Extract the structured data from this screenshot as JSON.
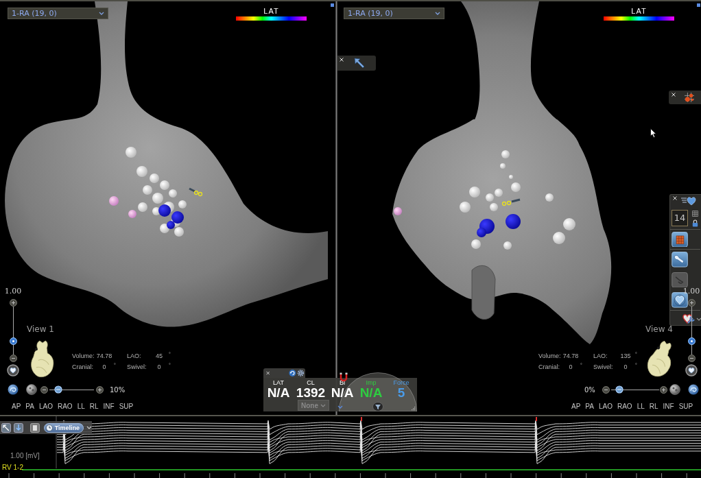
{
  "views": [
    {
      "map_selector": "1-RA (19, 0)",
      "scale_label": "LAT",
      "title": "View 1",
      "zoom": {
        "reading": "1.00",
        "level": 0.28
      },
      "stats": [
        {
          "label": "Volume:",
          "value": "74.78"
        },
        {
          "label": "LAO:",
          "value": "45",
          "unit": "°"
        },
        {
          "label": "Cranial:",
          "value": "0",
          "unit": "°"
        },
        {
          "label": "Swivel:",
          "value": "0",
          "unit": "°"
        }
      ],
      "transparency": {
        "reading": "10%",
        "level": 0.2
      },
      "view_buttons": [
        "AP",
        "PA",
        "LAO",
        "RAO",
        "LL",
        "RL",
        "INF",
        "SUP"
      ]
    },
    {
      "map_selector": "1-RA (19, 0)",
      "scale_label": "LAT",
      "title": "View 4",
      "zoom": {
        "reading": "1.00",
        "level": 0.28
      },
      "stats": [
        {
          "label": "Volume:",
          "value": "74.78"
        },
        {
          "label": "LAO:",
          "value": "135",
          "unit": "°"
        },
        {
          "label": "Cranial:",
          "value": "0",
          "unit": "°"
        },
        {
          "label": "Swivel:",
          "value": "0",
          "unit": "°"
        }
      ],
      "transparency": {
        "reading": "0%",
        "level": 0.17
      },
      "view_buttons": [
        "AP",
        "PA",
        "LAO",
        "RAO",
        "LL",
        "RL",
        "INF",
        "SUP"
      ],
      "point_count": "14"
    }
  ],
  "readout_panel": {
    "readouts": [
      {
        "label": "LAT",
        "value": "N/A",
        "color": "#ffffff"
      },
      {
        "label": "CL",
        "value": "1392",
        "color": "#ffffff"
      },
      {
        "label": "Bi",
        "value": "N/A",
        "color": "#ffffff"
      },
      {
        "label": "Imp",
        "value": "N/A",
        "color": "#2ecc40"
      },
      {
        "label": "Force",
        "value": "5",
        "color": "#4a9be8"
      }
    ],
    "channel_select": "None"
  },
  "signals": {
    "timeline_button": "Timeline",
    "scale": "1.00 [mV]",
    "channel": "RV 1-2"
  }
}
